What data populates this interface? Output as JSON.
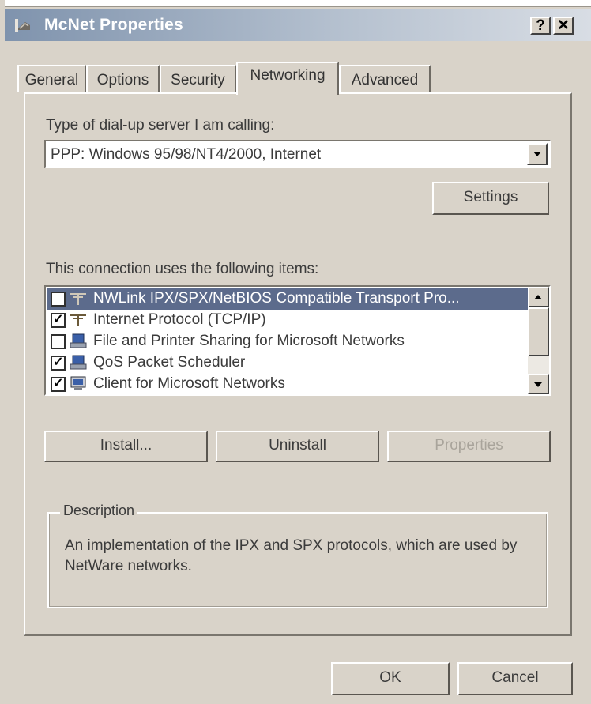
{
  "window": {
    "title": "McNet Properties",
    "help_button": "?",
    "close_button": "✕"
  },
  "tabs": [
    {
      "label": "General"
    },
    {
      "label": "Options"
    },
    {
      "label": "Security"
    },
    {
      "label": "Networking"
    },
    {
      "label": "Advanced"
    }
  ],
  "active_tab": "Networking",
  "server_type": {
    "label": "Type of dial-up server I am calling:",
    "selected": "PPP: Windows 95/98/NT4/2000, Internet"
  },
  "settings_button": "Settings",
  "items": {
    "label": "This connection uses the following items:",
    "list": [
      {
        "label": "NWLink IPX/SPX/NetBIOS Compatible Transport Pro...",
        "checked": false,
        "selected": true,
        "icon": "protocol-icon"
      },
      {
        "label": "Internet Protocol (TCP/IP)",
        "checked": true,
        "selected": false,
        "icon": "protocol-icon"
      },
      {
        "label": "File and Printer Sharing for Microsoft Networks",
        "checked": false,
        "selected": false,
        "icon": "service-icon"
      },
      {
        "label": "QoS Packet Scheduler",
        "checked": true,
        "selected": false,
        "icon": "service-icon"
      },
      {
        "label": "Client for Microsoft Networks",
        "checked": true,
        "selected": false,
        "icon": "client-icon"
      }
    ]
  },
  "buttons": {
    "install": "Install...",
    "uninstall": "Uninstall",
    "properties": "Properties",
    "ok": "OK",
    "cancel": "Cancel"
  },
  "description": {
    "title": "Description",
    "text": "An implementation of the IPX and SPX protocols, which are used by NetWare networks."
  }
}
